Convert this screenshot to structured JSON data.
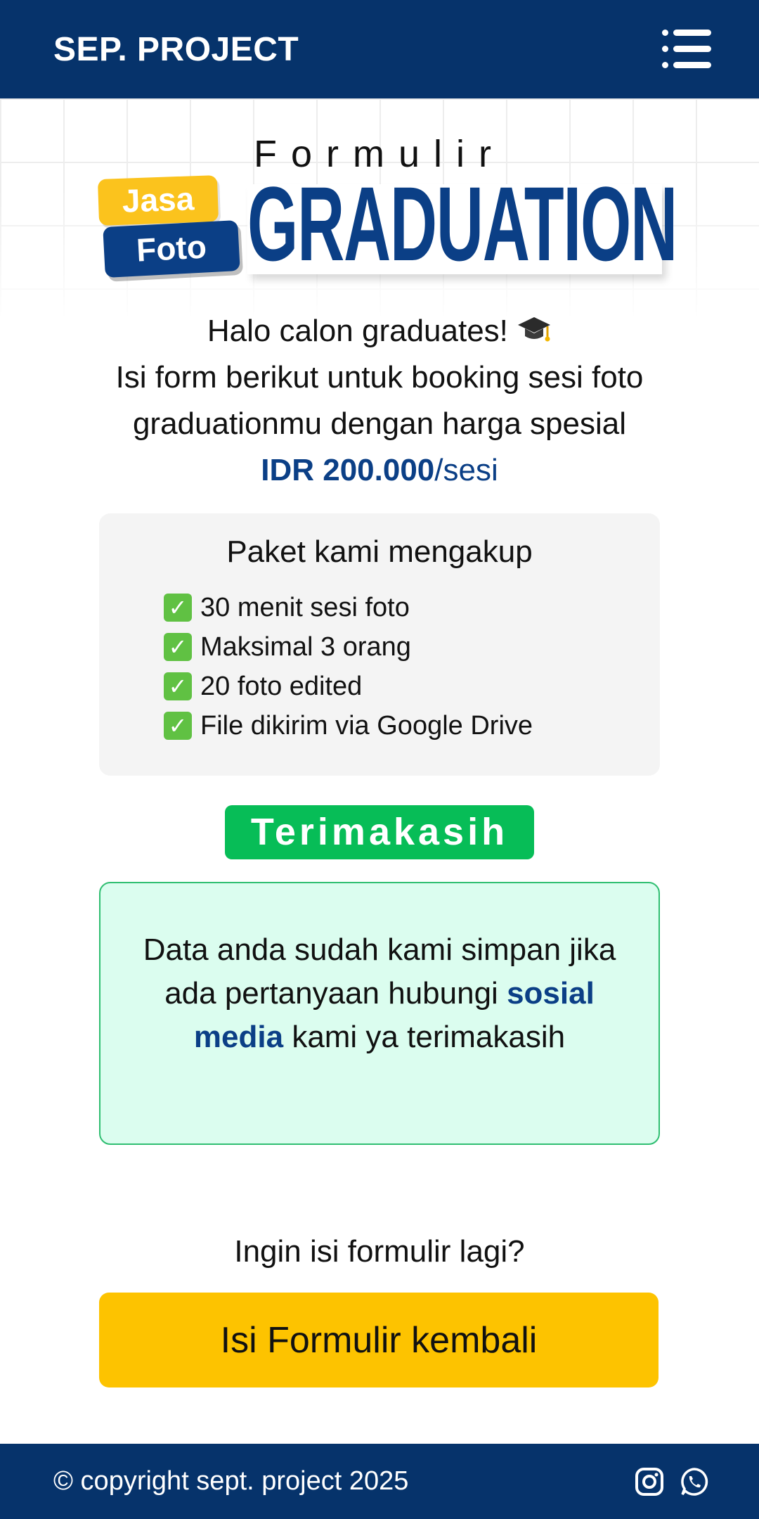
{
  "navbar": {
    "brand": "SEP. PROJECT",
    "menu_icon": "hamburger-menu-icon"
  },
  "hero": {
    "formulir": "Formulir",
    "jasa": "Jasa",
    "foto": "Foto",
    "graduation": "GRADUATION"
  },
  "intro": {
    "greeting": "Halo calon graduates!",
    "greeting_icon": "graduation-cap-icon",
    "line2": "Isi form berikut untuk booking sesi foto",
    "line3": "graduationmu dengan harga spesial",
    "price": "IDR 200.000",
    "unit": "/sesi"
  },
  "package": {
    "title": "Paket kami mengakup",
    "items": [
      "30 menit sesi foto",
      "Maksimal 3 orang",
      "20 foto edited",
      "File dikirim via Google Drive"
    ],
    "check_icon": "checkmark-icon"
  },
  "thanks": {
    "badge": "Terimakasih",
    "msg_part1": "Data anda sudah kami simpan jika ada pertanyaan hubungi",
    "msg_highlight": "sosial media",
    "msg_part2": "kami ya terimakasih"
  },
  "again": {
    "label": "Ingin isi formulir lagi?",
    "button": "Isi Formulir kembali"
  },
  "footer": {
    "copyright": "© copyright sept. project 2025",
    "icons": [
      "instagram-icon",
      "whatsapp-icon"
    ]
  },
  "colors": {
    "navy": "#06336b",
    "brand_blue": "#0b3f86",
    "yellow": "#fdc300",
    "green": "#07bd57",
    "mint": "#dbfdef"
  }
}
